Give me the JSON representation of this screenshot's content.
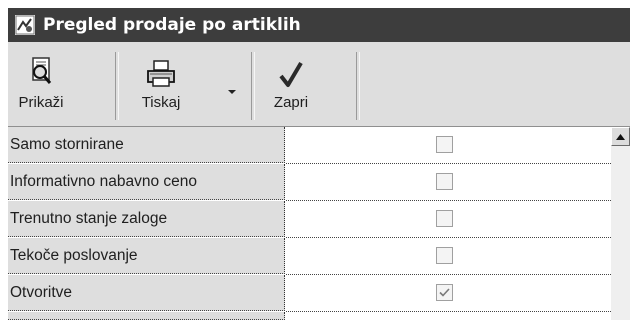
{
  "window": {
    "title": "Pregled prodaje po artiklih"
  },
  "toolbar": {
    "show_label": "Prikaži",
    "print_label": "Tiskaj",
    "close_label": "Zapri"
  },
  "rows": [
    {
      "label": "Samo stornirane",
      "checked": false
    },
    {
      "label": "Informativno nabavno ceno",
      "checked": false
    },
    {
      "label": "Trenutno stanje zaloge",
      "checked": false
    },
    {
      "label": "Tekoče poslovanje",
      "checked": false
    },
    {
      "label": "Otvoritve",
      "checked": true
    }
  ]
}
